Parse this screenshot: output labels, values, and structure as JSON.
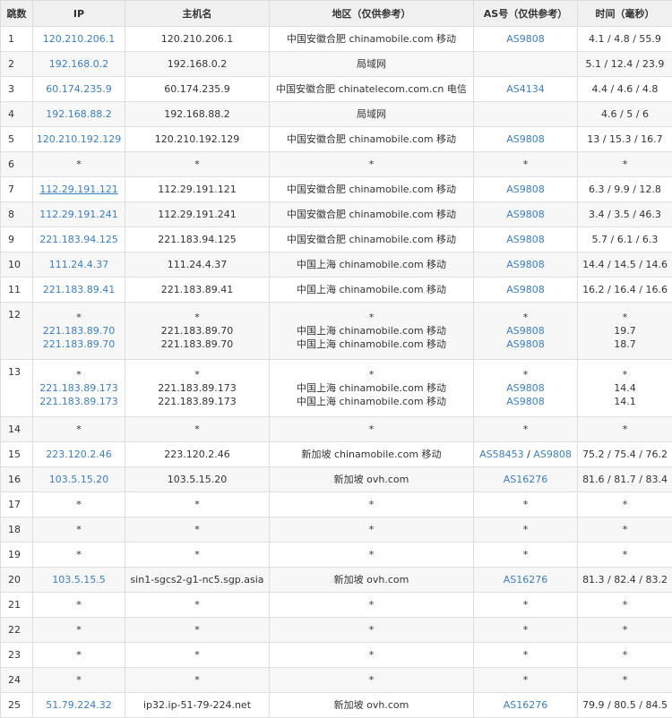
{
  "headers": [
    "跳数",
    "IP",
    "主机名",
    "地区（仅供参考）",
    "AS号（仅供参考）",
    "时间（毫秒）"
  ],
  "rows": [
    {
      "hop": "1",
      "ip": [
        "120.210.206.1"
      ],
      "host": [
        "120.210.206.1"
      ],
      "region": [
        "中国安徽合肥 chinamobile.com 移动"
      ],
      "as": [
        [
          "AS9808"
        ]
      ],
      "time": [
        "4.1 / 4.8 / 55.9"
      ]
    },
    {
      "hop": "2",
      "ip": [
        "192.168.0.2"
      ],
      "host": [
        "192.168.0.2"
      ],
      "region": [
        "局域网"
      ],
      "as": [
        []
      ],
      "time": [
        "5.1 / 12.4 / 23.9"
      ]
    },
    {
      "hop": "3",
      "ip": [
        "60.174.235.9"
      ],
      "host": [
        "60.174.235.9"
      ],
      "region": [
        "中国安徽合肥 chinatelecom.com.cn 电信"
      ],
      "as": [
        [
          "AS4134"
        ]
      ],
      "time": [
        "4.4 / 4.6 / 4.8"
      ]
    },
    {
      "hop": "4",
      "ip": [
        "192.168.88.2"
      ],
      "host": [
        "192.168.88.2"
      ],
      "region": [
        "局域网"
      ],
      "as": [
        []
      ],
      "time": [
        "4.6 / 5 / 6"
      ]
    },
    {
      "hop": "5",
      "ip": [
        "120.210.192.129"
      ],
      "host": [
        "120.210.192.129"
      ],
      "region": [
        "中国安徽合肥 chinamobile.com 移动"
      ],
      "as": [
        [
          "AS9808"
        ]
      ],
      "time": [
        "13 / 15.3 / 16.7"
      ]
    },
    {
      "hop": "6",
      "ip": [
        "*"
      ],
      "host": [
        "*"
      ],
      "region": [
        "*"
      ],
      "as": [
        [
          "*"
        ]
      ],
      "time": [
        "*"
      ]
    },
    {
      "hop": "7",
      "ip": [
        "112.29.191.121"
      ],
      "host": [
        "112.29.191.121"
      ],
      "region": [
        "中国安徽合肥 chinamobile.com 移动"
      ],
      "as": [
        [
          "AS9808"
        ]
      ],
      "time": [
        "6.3 / 9.9 / 12.8"
      ],
      "underline": true
    },
    {
      "hop": "8",
      "ip": [
        "112.29.191.241"
      ],
      "host": [
        "112.29.191.241"
      ],
      "region": [
        "中国安徽合肥 chinamobile.com 移动"
      ],
      "as": [
        [
          "AS9808"
        ]
      ],
      "time": [
        "3.4 / 3.5 / 46.3"
      ]
    },
    {
      "hop": "9",
      "ip": [
        "221.183.94.125"
      ],
      "host": [
        "221.183.94.125"
      ],
      "region": [
        "中国安徽合肥 chinamobile.com 移动"
      ],
      "as": [
        [
          "AS9808"
        ]
      ],
      "time": [
        "5.7 / 6.1 / 6.3"
      ]
    },
    {
      "hop": "10",
      "ip": [
        "111.24.4.37"
      ],
      "host": [
        "111.24.4.37"
      ],
      "region": [
        "中国上海 chinamobile.com 移动"
      ],
      "as": [
        [
          "AS9808"
        ]
      ],
      "time": [
        "14.4 / 14.5 / 14.6"
      ]
    },
    {
      "hop": "11",
      "ip": [
        "221.183.89.41"
      ],
      "host": [
        "221.183.89.41"
      ],
      "region": [
        "中国上海 chinamobile.com 移动"
      ],
      "as": [
        [
          "AS9808"
        ]
      ],
      "time": [
        "16.2 / 16.4 / 16.6"
      ]
    },
    {
      "hop": "12",
      "ip": [
        "*",
        "221.183.89.70",
        "221.183.89.70"
      ],
      "host": [
        "*",
        "221.183.89.70",
        "221.183.89.70"
      ],
      "region": [
        "*",
        "中国上海 chinamobile.com 移动",
        "中国上海 chinamobile.com 移动"
      ],
      "as": [
        [
          "*"
        ],
        [
          "AS9808"
        ],
        [
          "AS9808"
        ]
      ],
      "time": [
        "*",
        "19.7",
        "18.7"
      ]
    },
    {
      "hop": "13",
      "ip": [
        "*",
        "221.183.89.173",
        "221.183.89.173"
      ],
      "host": [
        "*",
        "221.183.89.173",
        "221.183.89.173"
      ],
      "region": [
        "*",
        "中国上海 chinamobile.com 移动",
        "中国上海 chinamobile.com 移动"
      ],
      "as": [
        [
          "*"
        ],
        [
          "AS9808"
        ],
        [
          "AS9808"
        ]
      ],
      "time": [
        "*",
        "14.4",
        "14.1"
      ]
    },
    {
      "hop": "14",
      "ip": [
        "*"
      ],
      "host": [
        "*"
      ],
      "region": [
        "*"
      ],
      "as": [
        [
          "*"
        ]
      ],
      "time": [
        "*"
      ]
    },
    {
      "hop": "15",
      "ip": [
        "223.120.2.46"
      ],
      "host": [
        "223.120.2.46"
      ],
      "region": [
        "新加坡 chinamobile.com 移动"
      ],
      "as": [
        [
          "AS58453",
          "AS9808"
        ]
      ],
      "time": [
        "75.2 / 75.4 / 76.2"
      ]
    },
    {
      "hop": "16",
      "ip": [
        "103.5.15.20"
      ],
      "host": [
        "103.5.15.20"
      ],
      "region": [
        "新加坡 ovh.com"
      ],
      "as": [
        [
          "AS16276"
        ]
      ],
      "time": [
        "81.6 / 81.7 / 83.4"
      ]
    },
    {
      "hop": "17",
      "ip": [
        "*"
      ],
      "host": [
        "*"
      ],
      "region": [
        "*"
      ],
      "as": [
        [
          "*"
        ]
      ],
      "time": [
        "*"
      ]
    },
    {
      "hop": "18",
      "ip": [
        "*"
      ],
      "host": [
        "*"
      ],
      "region": [
        "*"
      ],
      "as": [
        [
          "*"
        ]
      ],
      "time": [
        "*"
      ]
    },
    {
      "hop": "19",
      "ip": [
        "*"
      ],
      "host": [
        "*"
      ],
      "region": [
        "*"
      ],
      "as": [
        [
          "*"
        ]
      ],
      "time": [
        "*"
      ]
    },
    {
      "hop": "20",
      "ip": [
        "103.5.15.5"
      ],
      "host": [
        "sin1-sgcs2-g1-nc5.sgp.asia"
      ],
      "region": [
        "新加坡 ovh.com"
      ],
      "as": [
        [
          "AS16276"
        ]
      ],
      "time": [
        "81.3 / 82.4 / 83.2"
      ]
    },
    {
      "hop": "21",
      "ip": [
        "*"
      ],
      "host": [
        "*"
      ],
      "region": [
        "*"
      ],
      "as": [
        [
          "*"
        ]
      ],
      "time": [
        "*"
      ]
    },
    {
      "hop": "22",
      "ip": [
        "*"
      ],
      "host": [
        "*"
      ],
      "region": [
        "*"
      ],
      "as": [
        [
          "*"
        ]
      ],
      "time": [
        "*"
      ]
    },
    {
      "hop": "23",
      "ip": [
        "*"
      ],
      "host": [
        "*"
      ],
      "region": [
        "*"
      ],
      "as": [
        [
          "*"
        ]
      ],
      "time": [
        "*"
      ]
    },
    {
      "hop": "24",
      "ip": [
        "*"
      ],
      "host": [
        "*"
      ],
      "region": [
        "*"
      ],
      "as": [
        [
          "*"
        ]
      ],
      "time": [
        "*"
      ]
    },
    {
      "hop": "25",
      "ip": [
        "51.79.224.32"
      ],
      "host": [
        "ip32.ip-51-79-224.net"
      ],
      "region": [
        "新加坡 ovh.com"
      ],
      "as": [
        [
          "AS16276"
        ]
      ],
      "time": [
        "79.9 / 80.5 / 84.5"
      ]
    }
  ],
  "colors": {
    "link": "#3a7fc1",
    "border": "#dddddd",
    "header_bg": "#f0f0f0",
    "alt_row_bg": "#f7f7f7"
  }
}
